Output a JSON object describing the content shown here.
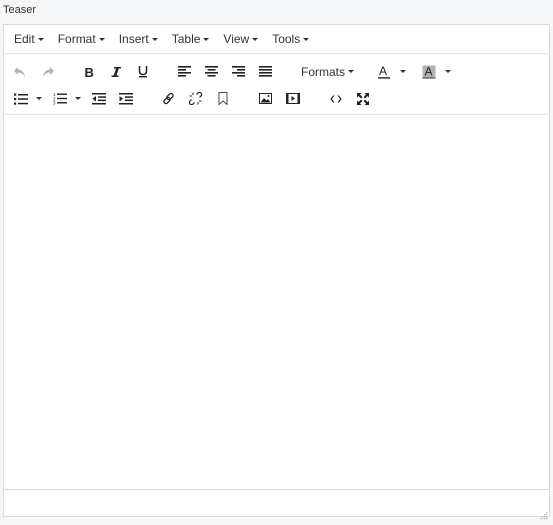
{
  "field": {
    "label": "Teaser"
  },
  "menubar": {
    "items": [
      {
        "label": "Edit"
      },
      {
        "label": "Format"
      },
      {
        "label": "Insert"
      },
      {
        "label": "Table"
      },
      {
        "label": "View"
      },
      {
        "label": "Tools"
      }
    ]
  },
  "toolbar": {
    "formats_label": "Formats",
    "text_color_glyph": "A",
    "bg_color_glyph": "A",
    "row1_icons": [
      "undo-icon",
      "redo-icon",
      "bold-icon",
      "italic-icon",
      "underline-icon",
      "align-left-icon",
      "align-center-icon",
      "align-right-icon",
      "align-justify-icon",
      "formats-dropdown",
      "text-color-icon",
      "background-color-icon"
    ],
    "row2_icons": [
      "bullet-list-icon",
      "numbered-list-icon",
      "outdent-icon",
      "indent-icon",
      "link-icon",
      "unlink-icon",
      "bookmark-icon",
      "image-icon",
      "media-icon",
      "code-icon",
      "fullscreen-icon"
    ]
  },
  "colors": {
    "page_bg": "#f5f6f7",
    "border": "#d9dce0",
    "icon": "#222222",
    "icon_disabled": "#b3b3b3",
    "bg_color_swatch": "#b3b3b3"
  },
  "content": {
    "text": ""
  }
}
